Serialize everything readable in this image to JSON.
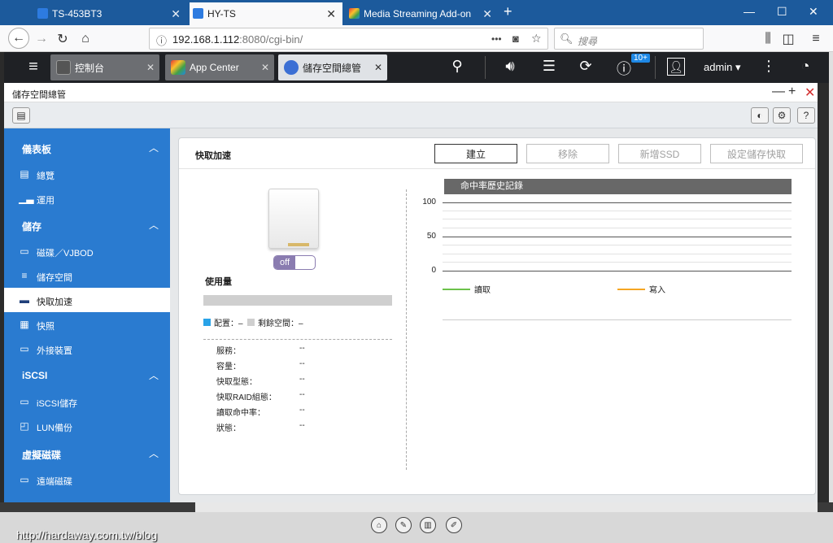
{
  "browser": {
    "tabs": [
      {
        "label": "TS-453BT3",
        "active": false
      },
      {
        "label": "HY-TS",
        "active": true
      },
      {
        "label": "Media Streaming Add-on",
        "active": false
      }
    ],
    "new_tab": "+",
    "url_host": "192.168.1.112",
    "url_rest": ":8080/cgi-bin/",
    "search_placeholder": "搜尋",
    "more": "•••"
  },
  "app_header": {
    "tabs": [
      {
        "label": "控制台"
      },
      {
        "label": "App Center"
      },
      {
        "label": "儲存空間總管"
      }
    ],
    "notification_count": "10+",
    "user": "admin ▾"
  },
  "window": {
    "title": "儲存空間總管"
  },
  "sidebar": {
    "sections": [
      {
        "label": "儀表板",
        "items": [
          {
            "label": "總覽"
          },
          {
            "label": "運用"
          }
        ]
      },
      {
        "label": "儲存",
        "items": [
          {
            "label": "磁碟／VJBOD"
          },
          {
            "label": "儲存空間"
          },
          {
            "label": "快取加速"
          },
          {
            "label": "快照"
          },
          {
            "label": "外接裝置"
          }
        ]
      },
      {
        "label": "iSCSI",
        "items": [
          {
            "label": "iSCSI儲存"
          },
          {
            "label": "LUN備份"
          }
        ]
      },
      {
        "label": "虛擬磁碟",
        "items": [
          {
            "label": "遠端磁碟"
          }
        ]
      }
    ]
  },
  "panel": {
    "title": "快取加速",
    "buttons": {
      "create": "建立",
      "remove": "移除",
      "add_ssd": "新增SSD",
      "config": "設定儲存快取"
    },
    "toggle": "off",
    "usage_label": "使用量",
    "legend_allocated": "配置：–",
    "legend_free": "剩餘空間：–",
    "properties": [
      {
        "key": "服務：",
        "value": "--"
      },
      {
        "key": "容量：",
        "value": "--"
      },
      {
        "key": "快取型態：",
        "value": "--"
      },
      {
        "key": "快取RAID組態：",
        "value": "--"
      },
      {
        "key": "讀取命中率：",
        "value": "--"
      },
      {
        "key": "狀態：",
        "value": "--"
      }
    ]
  },
  "chart_data": {
    "type": "line",
    "title": "命中率歷史記錄",
    "yticks": [
      "100",
      "50",
      "0"
    ],
    "ylim": [
      0,
      100
    ],
    "series": [
      {
        "name": "讀取",
        "color": "#6cc24a",
        "values": []
      },
      {
        "name": "寫入",
        "color": "#f5a623",
        "values": []
      }
    ]
  },
  "colors": {
    "sidebar": "#2a7bd0",
    "browser_tabbar": "#1c5a9c",
    "qts_header": "#1f2125"
  },
  "watermark": "http://hardaway.com.tw/blog"
}
